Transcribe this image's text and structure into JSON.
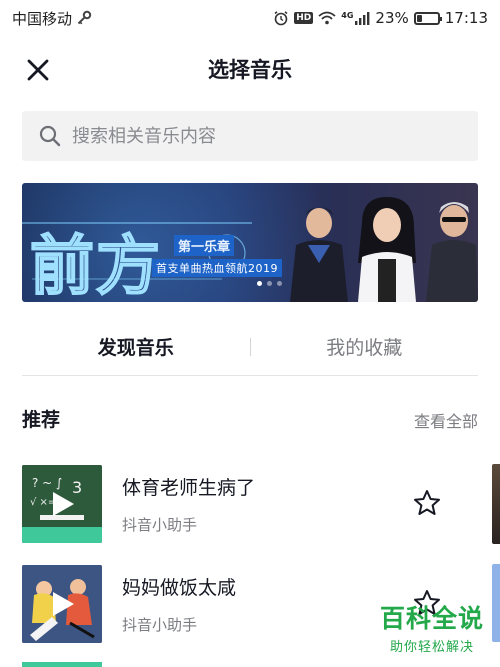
{
  "status_bar": {
    "carrier": "中国移动",
    "network": "4G",
    "battery": "23%",
    "battery_level": 0.23,
    "time": "17:13",
    "hd_label": "HD"
  },
  "header": {
    "title": "选择音乐"
  },
  "search": {
    "placeholder": "搜索相关音乐内容"
  },
  "banner": {
    "headline": "前方",
    "chapter": "第一乐章",
    "slogan": "首支单曲热血领航2019",
    "slide_count": 3,
    "active_slide": 1
  },
  "tabs": [
    {
      "label": "发现音乐",
      "active": true
    },
    {
      "label": "我的收藏",
      "active": false
    }
  ],
  "recommend": {
    "title": "推荐",
    "see_all": "查看全部",
    "items": [
      {
        "title": "体育老师生病了",
        "author": "抖音小助手"
      },
      {
        "title": "妈妈做饭太咸",
        "author": "抖音小助手"
      }
    ]
  },
  "watermark": {
    "logo": "百科全说",
    "subtitle": "助你轻松解决"
  },
  "colors": {
    "accent_green": "#23a84a",
    "banner_blue": "#1e63c7",
    "text_primary": "#161823",
    "text_secondary": "#7c7d83"
  }
}
